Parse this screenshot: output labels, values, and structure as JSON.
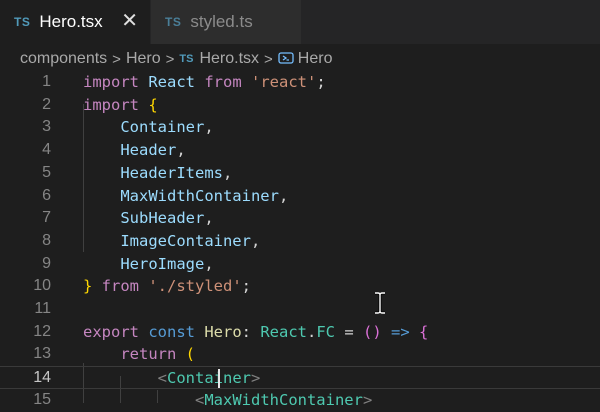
{
  "tabs": [
    {
      "type_badge": "TS",
      "label": "Hero.tsx",
      "active": true
    },
    {
      "type_badge": "TS",
      "label": "styled.ts",
      "active": false
    }
  ],
  "close_glyph": "✕",
  "breadcrumb": {
    "items": [
      "components",
      "Hero",
      "Hero.tsx",
      "Hero"
    ],
    "file_badge": "TS",
    "separator": ">"
  },
  "editor": {
    "line_numbers": [
      "1",
      "2",
      "3",
      "4",
      "5",
      "6",
      "7",
      "8",
      "9",
      "10",
      "11",
      "12",
      "13",
      "14",
      "15"
    ],
    "current_line": "14",
    "lines": [
      [
        [
          "kw",
          "import "
        ],
        [
          "id",
          "React "
        ],
        [
          "kw",
          "from "
        ],
        [
          "str",
          "'react'"
        ],
        [
          "p",
          ";"
        ]
      ],
      [
        [
          "kw",
          "import "
        ],
        [
          "br",
          "{"
        ]
      ],
      [
        [
          "p",
          "    "
        ],
        [
          "id",
          "Container"
        ],
        [
          "p",
          ","
        ]
      ],
      [
        [
          "p",
          "    "
        ],
        [
          "id",
          "Header"
        ],
        [
          "p",
          ","
        ]
      ],
      [
        [
          "p",
          "    "
        ],
        [
          "id",
          "HeaderItems"
        ],
        [
          "p",
          ","
        ]
      ],
      [
        [
          "p",
          "    "
        ],
        [
          "id",
          "MaxWidthContainer"
        ],
        [
          "p",
          ","
        ]
      ],
      [
        [
          "p",
          "    "
        ],
        [
          "id",
          "SubHeader"
        ],
        [
          "p",
          ","
        ]
      ],
      [
        [
          "p",
          "    "
        ],
        [
          "id",
          "ImageContainer"
        ],
        [
          "p",
          ","
        ]
      ],
      [
        [
          "p",
          "    "
        ],
        [
          "id",
          "HeroImage"
        ],
        [
          "p",
          ","
        ]
      ],
      [
        [
          "br",
          "} "
        ],
        [
          "kw",
          "from "
        ],
        [
          "str",
          "'./styled'"
        ],
        [
          "p",
          ";"
        ]
      ],
      [],
      [
        [
          "kw",
          "export "
        ],
        [
          "kw2",
          "const "
        ],
        [
          "fn",
          "Hero"
        ],
        [
          "p",
          ": "
        ],
        [
          "ty",
          "React"
        ],
        [
          "p",
          "."
        ],
        [
          "ty",
          "FC"
        ],
        [
          "p",
          " = "
        ],
        [
          "br2",
          "()"
        ],
        [
          "kw2",
          " => "
        ],
        [
          "br2",
          "{"
        ]
      ],
      [
        [
          "p",
          "    "
        ],
        [
          "kw",
          "return "
        ],
        [
          "br",
          "("
        ]
      ],
      [
        [
          "p",
          "        "
        ],
        [
          "tag",
          "<"
        ],
        [
          "ty",
          "Container"
        ],
        [
          "tag",
          ">"
        ]
      ],
      [
        [
          "p",
          "            "
        ],
        [
          "tag",
          "<"
        ],
        [
          "ty",
          "MaxWidthContainer"
        ],
        [
          "tag",
          ">"
        ]
      ]
    ]
  },
  "colors": {
    "background": "#1e1e1e",
    "tabbar": "#252526",
    "keyword": "#c586c0",
    "identifier": "#9cdcfe",
    "type": "#4ec9b0",
    "string": "#ce9178"
  },
  "icons": [
    "close-icon",
    "symbol-method-icon",
    "text-cursor-icon"
  ]
}
